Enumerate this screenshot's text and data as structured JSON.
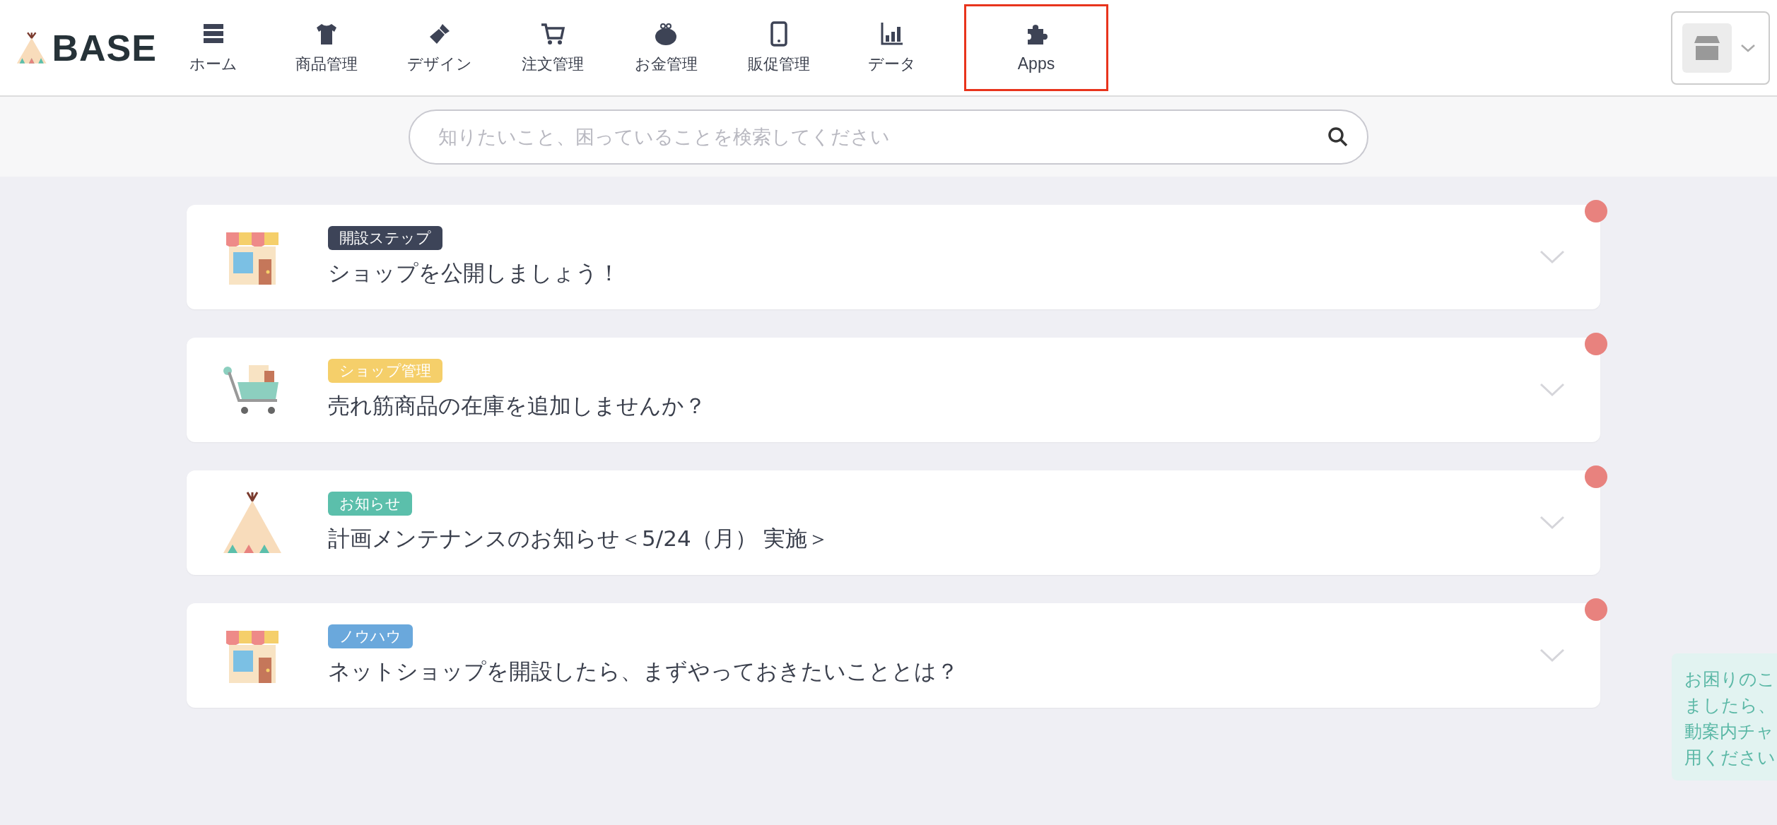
{
  "header": {
    "logo": "BASE",
    "nav": [
      {
        "kind": "list",
        "label": "ホーム",
        "highlighted": false
      },
      {
        "kind": "shirt",
        "label": "商品管理",
        "highlighted": false
      },
      {
        "kind": "brush",
        "label": "デザイン",
        "highlighted": false
      },
      {
        "kind": "cart",
        "label": "注文管理",
        "highlighted": false
      },
      {
        "kind": "purse",
        "label": "お金管理",
        "highlighted": false
      },
      {
        "kind": "phone",
        "label": "販促管理",
        "highlighted": false
      },
      {
        "kind": "chart",
        "label": "データ",
        "highlighted": false
      },
      {
        "kind": "puzzle",
        "label": "Apps",
        "highlighted": true
      }
    ]
  },
  "search": {
    "placeholder": "知りたいこと、困っていることを検索してください"
  },
  "cards": [
    {
      "kind": "shop",
      "tag": "開設ステップ",
      "color": "#3d4458",
      "title": "ショップを公開しましょう！",
      "unread": true
    },
    {
      "kind": "cart",
      "tag": "ショップ管理",
      "color": "#f5cf6a",
      "title": "売れ筋商品の在庫を追加しませんか？",
      "unread": true
    },
    {
      "kind": "tent",
      "tag": "お知らせ",
      "color": "#5bbfab",
      "title": "計画メンテナンスのお知らせ＜5/24（月） 実施＞",
      "unread": true
    },
    {
      "kind": "shop",
      "tag": "ノウハウ",
      "color": "#6aa8dc",
      "title": "ネットショップを開設したら、まずやっておきたいこととは？",
      "unread": true
    }
  ],
  "chat_hint": {
    "lines": [
      "お困りのこ",
      "ましたら、",
      "動案内チャ",
      "用ください"
    ]
  }
}
